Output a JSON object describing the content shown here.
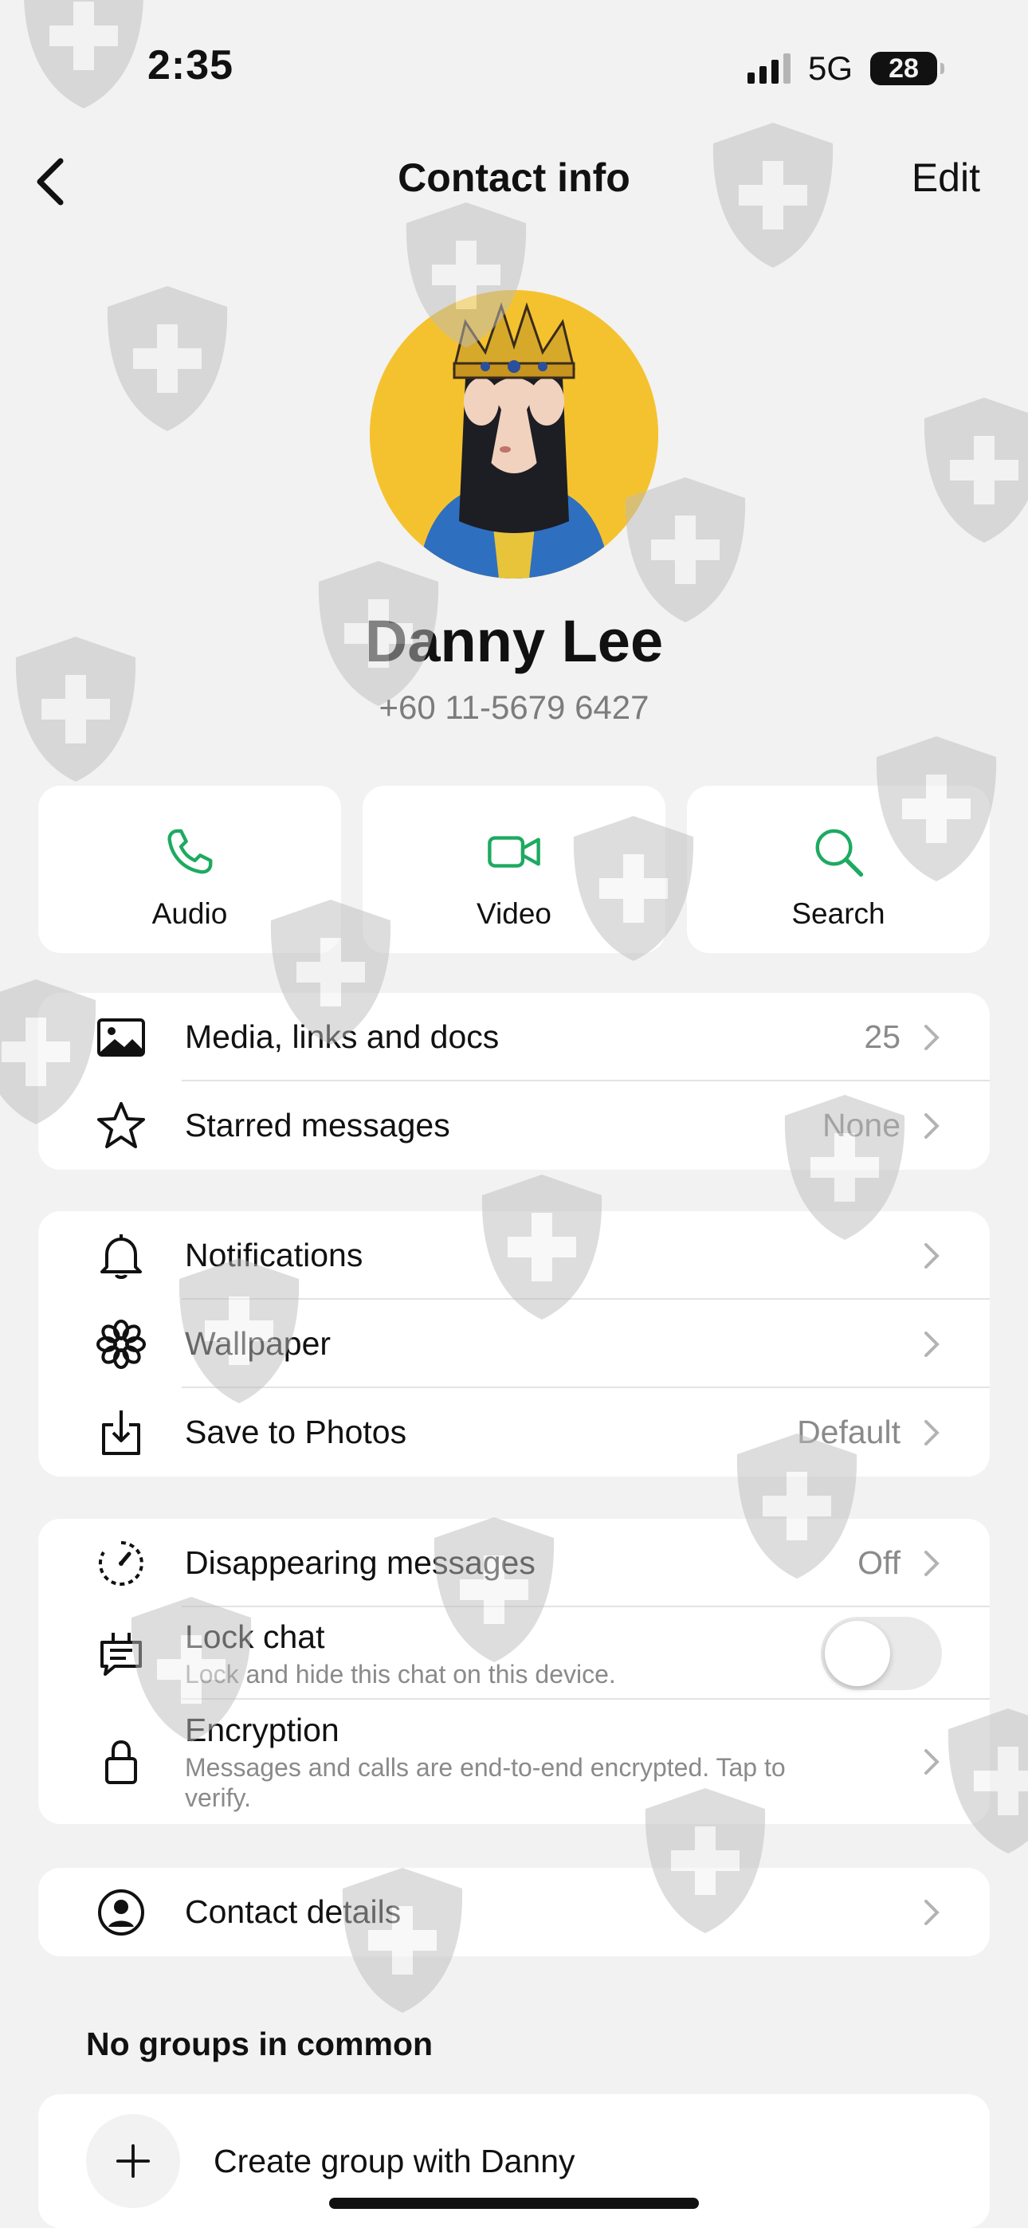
{
  "status": {
    "time": "2:35",
    "network": "5G",
    "battery": "28"
  },
  "nav": {
    "title": "Contact info",
    "edit": "Edit"
  },
  "contact": {
    "name": "Danny Lee",
    "phone": "+60 11-5679 6427"
  },
  "actions": [
    {
      "label": "Audio",
      "icon": "phone-icon"
    },
    {
      "label": "Video",
      "icon": "video-icon"
    },
    {
      "label": "Search",
      "icon": "search-icon"
    }
  ],
  "media_card": [
    {
      "label": "Media, links and docs",
      "value": "25",
      "icon": "image-icon"
    },
    {
      "label": "Starred messages",
      "value": "None",
      "icon": "star-icon"
    }
  ],
  "settings_card": [
    {
      "label": "Notifications",
      "value": "",
      "icon": "bell-icon"
    },
    {
      "label": "Wallpaper",
      "value": "",
      "icon": "flower-icon"
    },
    {
      "label": "Save to Photos",
      "value": "Default",
      "icon": "download-icon"
    }
  ],
  "privacy_card": {
    "disappearing": {
      "label": "Disappearing messages",
      "value": "Off"
    },
    "lock": {
      "label": "Lock chat",
      "sub": "Lock and hide this chat on this device.",
      "enabled": false
    },
    "encryption": {
      "label": "Encryption",
      "sub": "Messages and calls are end-to-end encrypted. Tap to verify."
    }
  },
  "contact_details": {
    "label": "Contact details"
  },
  "groups": {
    "heading": "No groups in common",
    "create": "Create group with Danny"
  },
  "colors": {
    "accent": "#1daa61",
    "background": "#f2f2f2",
    "card": "#ffffff",
    "muted": "#8a8a8a"
  }
}
